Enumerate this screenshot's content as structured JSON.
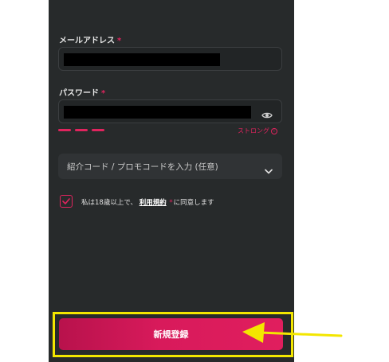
{
  "form": {
    "email_label": "メールアドレス",
    "password_label": "パスワード",
    "required_mark": "*",
    "strength_label": "ストロング",
    "strength_info_glyph": "i",
    "referral_label": "紹介コード / プロモコードを入力 (任意)",
    "terms_prefix": "私は18歳以上で、",
    "terms_link": "利用規約",
    "terms_suffix": "に同意します",
    "signup_label": "新規登録",
    "terms_checked": true
  },
  "icons": {
    "password_toggle": "eye-icon",
    "referral_expand": "chevron-down-icon",
    "checkbox": "checkmark-icon",
    "annotation": "arrow-left-icon"
  },
  "colors": {
    "panel_bg": "#272a2b",
    "accent": "#e0245e",
    "highlight": "#f3e600"
  }
}
